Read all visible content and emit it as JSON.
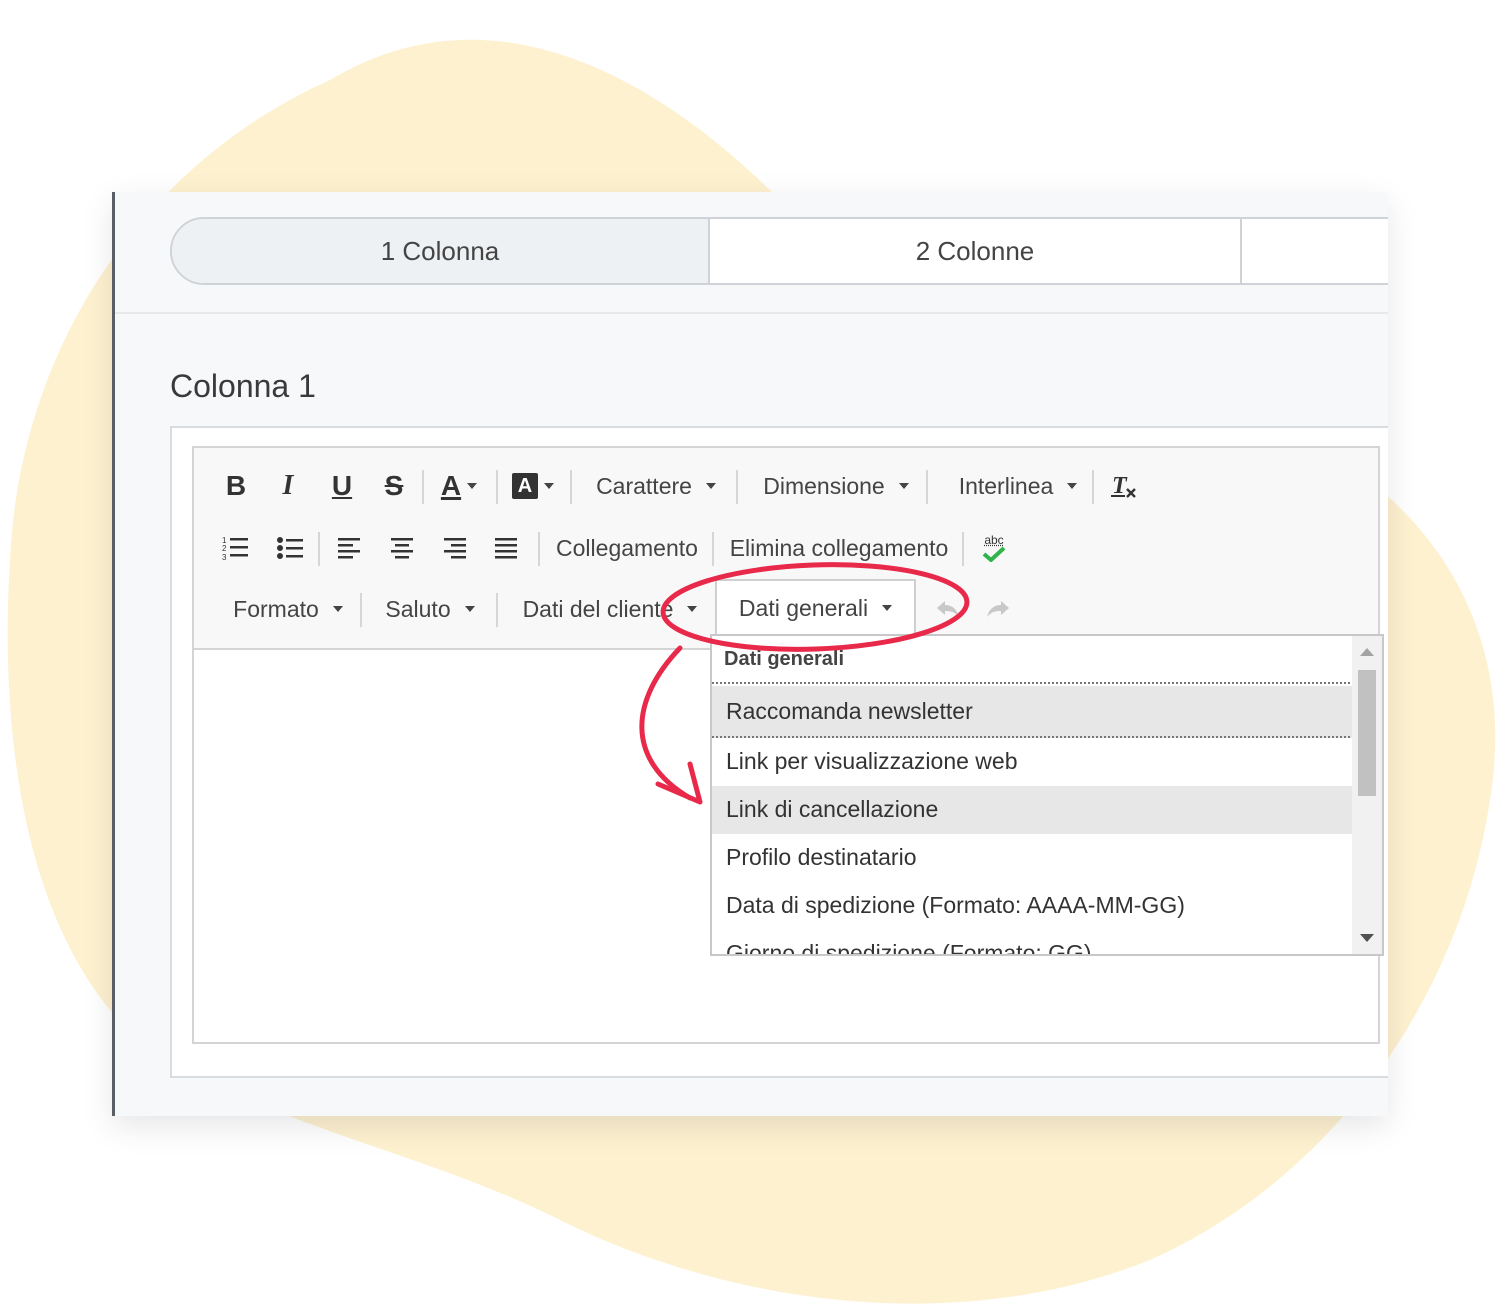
{
  "tabs": [
    "1 Colonna",
    "2 Colonne",
    ""
  ],
  "column_title": "Colonna 1",
  "toolbar": {
    "bold": "B",
    "italic": "I",
    "underline": "U",
    "strike": "S",
    "text_color": "A",
    "bg_color": "A",
    "font_label": "Carattere",
    "size_label": "Dimensione",
    "line_height_label": "Interlinea",
    "link_label": "Collegamento",
    "unlink_label": "Elimina collegamento",
    "spell_label": "abc",
    "format_label": "Formato",
    "greeting_label": "Saluto",
    "customer_data_label": "Dati del cliente",
    "general_data_label": "Dati generali"
  },
  "dropdown": {
    "header": "Dati generali",
    "items": [
      "Raccomanda newsletter",
      "Link per visualizzazione web",
      "Link di cancellazione",
      "Profilo destinatario",
      "Data di spedizione (Formato: AAAA-MM-GG)",
      "Giorno di spedizione (Formato: GG)"
    ]
  },
  "colors": {
    "blob": "#fdf1d0",
    "annotation": "#e8294a",
    "selected_row": "#e7e7e7"
  }
}
